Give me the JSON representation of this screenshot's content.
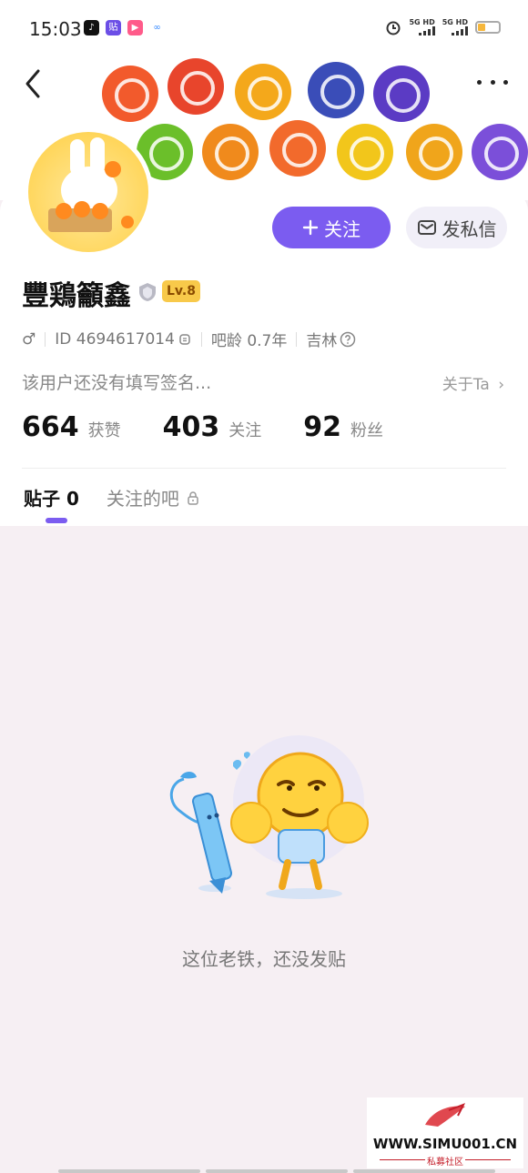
{
  "status_bar": {
    "time": "15:03",
    "app_icons": [
      {
        "name": "tiktok-icon",
        "glyph": "♪",
        "color": "#111111"
      },
      {
        "name": "tieba-icon",
        "glyph": "贴",
        "color": "#6b4ee6"
      },
      {
        "name": "bilibili-icon",
        "glyph": "▶",
        "color": "#ff5b8a"
      },
      {
        "name": "baidu-netdisk-icon",
        "glyph": "∞",
        "color": "#3a8bff"
      }
    ],
    "signal_1": "5G HD",
    "signal_2": "5G HD"
  },
  "header": {
    "banner_badges": [
      {
        "color": "#f25a2c"
      },
      {
        "color": "#e8452c"
      },
      {
        "color": "#f4a81b"
      },
      {
        "color": "#3a4db8"
      },
      {
        "color": "#5b3bc4"
      },
      {
        "color": "#6bbf2a"
      },
      {
        "color": "#f08a1c"
      },
      {
        "color": "#f26a2c"
      },
      {
        "color": "#f2c61b"
      },
      {
        "color": "#f0a51b"
      },
      {
        "color": "#7b4fd9"
      }
    ]
  },
  "profile": {
    "follow_label": "关注",
    "message_label": "发私信",
    "username": "豐鶏籲鑫",
    "level": "Lv.8",
    "gender_symbol": "♂",
    "id_text": "ID 4694617014",
    "bar_age": "吧龄 0.7年",
    "location": "吉林",
    "bio": "该用户还没有填写签名...",
    "about_link": "关于Ta",
    "stats": [
      {
        "value": "664",
        "label": "获赞"
      },
      {
        "value": "403",
        "label": "关注"
      },
      {
        "value": "92",
        "label": "粉丝"
      }
    ]
  },
  "tabs": [
    {
      "label": "贴子 0",
      "active": true
    },
    {
      "label": "关注的吧",
      "active": false,
      "locked": true
    }
  ],
  "empty_state": {
    "message": "这位老铁，还没发贴"
  },
  "watermark": {
    "site": "WWW.SIMU001.CN",
    "subtitle": "私募社区"
  },
  "colors": {
    "accent": "#7b5cf0",
    "background": "#f6eff3"
  }
}
